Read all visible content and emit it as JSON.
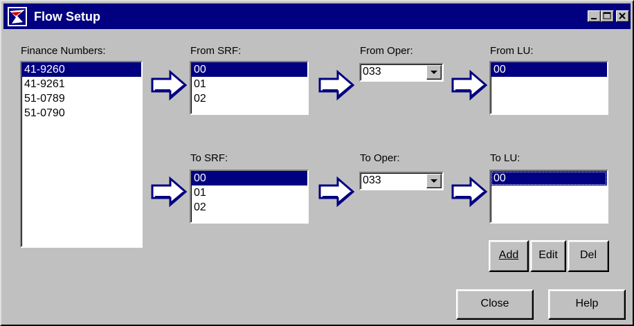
{
  "window": {
    "title": "Flow Setup",
    "icon": "usps-eagle-icon"
  },
  "labels": {
    "finance": "Finance Numbers:",
    "from_srf": "From SRF:",
    "from_oper": "From Oper:",
    "from_lu": "From LU:",
    "to_srf": "To SRF:",
    "to_oper": "To Oper:",
    "to_lu": "To LU:"
  },
  "finance_numbers": [
    "41-9260",
    "41-9261",
    "51-0789",
    "51-0790"
  ],
  "from_srf_items": [
    "00",
    "01",
    "02"
  ],
  "from_oper_value": "033",
  "from_lu_items": [
    "00"
  ],
  "to_srf_items": [
    "00",
    "01",
    "02"
  ],
  "to_oper_value": "033",
  "to_lu_items": [
    "00"
  ],
  "buttons": {
    "add": "Add",
    "edit": "Edit",
    "del": "Del",
    "close": "Close",
    "help": "Help"
  },
  "colors": {
    "selection": "#000080",
    "face": "#c0c0c0",
    "titlebar": "#000080"
  }
}
